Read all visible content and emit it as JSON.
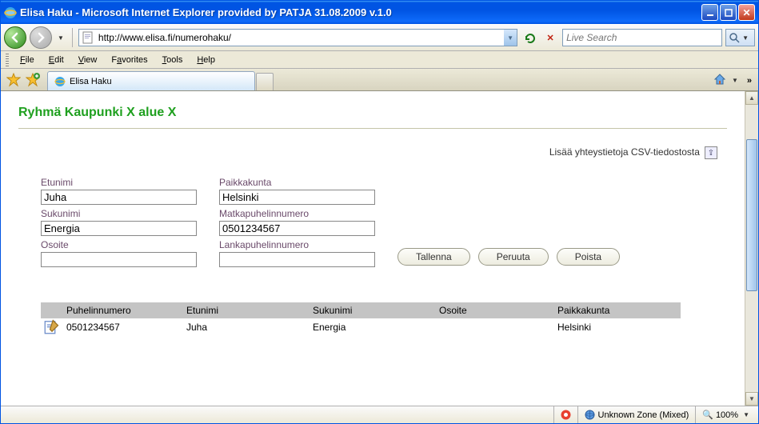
{
  "window": {
    "title": "Elisa Haku - Microsoft Internet Explorer provided by PATJA 31.08.2009 v.1.0"
  },
  "nav": {
    "url": "http://www.elisa.fi/numerohaku/",
    "search_placeholder": "Live Search"
  },
  "menu": {
    "file": "File",
    "edit": "Edit",
    "view": "View",
    "favorites": "Favorites",
    "tools": "Tools",
    "help": "Help"
  },
  "tab": {
    "title": "Elisa Haku"
  },
  "page": {
    "heading": "Ryhmä Kaupunki X alue X",
    "csv_label": "Lisää yhteystietoja CSV-tiedostosta",
    "labels": {
      "etunimi": "Etunimi",
      "sukunimi": "Sukunimi",
      "osoite": "Osoite",
      "paikkakunta": "Paikkakunta",
      "matkapuhelinnumero": "Matkapuhelinnumero",
      "lankapuhelinnumero": "Lankapuhelinnumero"
    },
    "values": {
      "etunimi": "Juha",
      "sukunimi": "Energia",
      "osoite": "",
      "paikkakunta": "Helsinki",
      "matkapuhelinnumero": "0501234567",
      "lankapuhelinnumero": ""
    },
    "buttons": {
      "tallenna": "Tallenna",
      "peruuta": "Peruuta",
      "poista": "Poista"
    },
    "table": {
      "headers": {
        "puhelinnumero": "Puhelinnumero",
        "etunimi": "Etunimi",
        "sukunimi": "Sukunimi",
        "osoite": "Osoite",
        "paikkakunta": "Paikkakunta"
      },
      "rows": [
        {
          "puhelinnumero": "0501234567",
          "etunimi": "Juha",
          "sukunimi": "Energia",
          "osoite": "",
          "paikkakunta": "Helsinki"
        }
      ]
    }
  },
  "status": {
    "zone": "Unknown Zone (Mixed)",
    "zoom": "100%"
  }
}
